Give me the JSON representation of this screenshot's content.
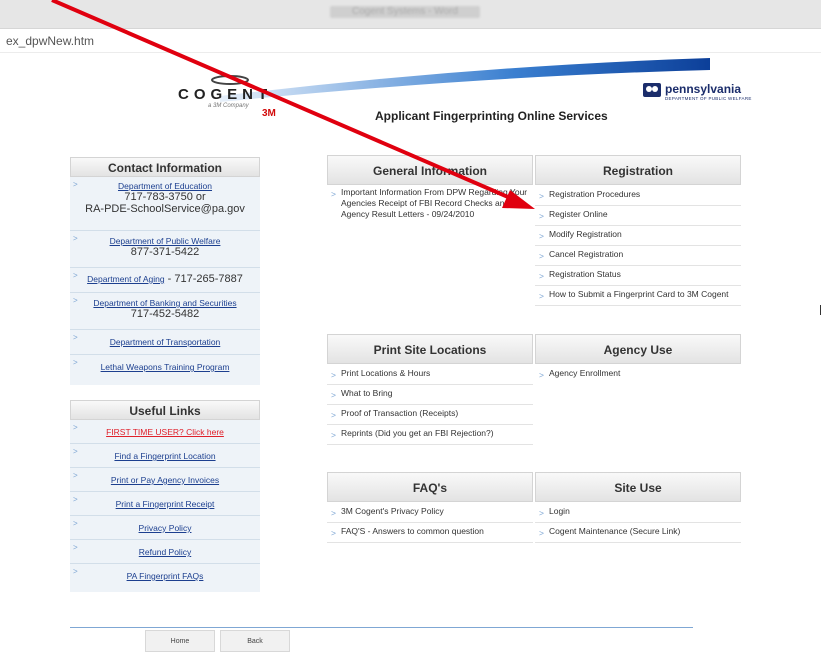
{
  "window": {
    "title": "Cogent Systems - Word"
  },
  "address": {
    "text": "ex_dpwNew.htm"
  },
  "header": {
    "logo_text": "COGENT",
    "logo_sub": "a 3M Company",
    "logo_3m": "3M",
    "pa_name": "pennsylvania",
    "pa_dept": "DEPARTMENT OF PUBLIC WELFARE",
    "site_title": "Applicant Fingerprinting Online Services"
  },
  "contact": {
    "title": "Contact Information",
    "education": {
      "label": "Department of Education",
      "phone": "717-783-3750 or",
      "email": "RA-PDE-SchoolService@pa.gov"
    },
    "welfare": {
      "label": "Department of Public Welfare",
      "phone": "877-371-5422"
    },
    "aging": {
      "label": "Department of Aging",
      "phone": " - 717-265-7887"
    },
    "banking": {
      "label": "Department of Banking and Securities",
      "phone": "717-452-5482"
    },
    "transport": {
      "label": "Department of Transportation"
    },
    "weapons": {
      "label": "Lethal Weapons Training Program"
    }
  },
  "useful": {
    "title": "Useful Links",
    "items": [
      {
        "label": "FIRST TIME USER? Click here"
      },
      {
        "label": "Find a Fingerprint Location"
      },
      {
        "label": "Print or Pay Agency Invoices"
      },
      {
        "label": "Print a Fingerprint Receipt"
      },
      {
        "label": "Privacy Policy"
      },
      {
        "label": "Refund Policy"
      },
      {
        "label": "PA Fingerprint FAQs"
      }
    ]
  },
  "general": {
    "title": "General Information",
    "items": [
      {
        "label": "Important Information From DPW Regarding Your Agencies Receipt of FBI Record Checks and Agency Result Letters - 09/24/2010"
      }
    ]
  },
  "registration": {
    "title": "Registration",
    "items": [
      {
        "label": "Registration Procedures"
      },
      {
        "label": "Register Online"
      },
      {
        "label": "Modify Registration"
      },
      {
        "label": "Cancel Registration"
      },
      {
        "label": "Registration Status"
      },
      {
        "label": "How to Submit a Fingerprint Card to 3M Cogent"
      }
    ]
  },
  "print_sites": {
    "title": "Print Site Locations",
    "items": [
      {
        "label": "Print Locations & Hours"
      },
      {
        "label": "What to Bring"
      },
      {
        "label": "Proof of Transaction (Receipts)"
      },
      {
        "label": "Reprints (Did you get an FBI Rejection?)"
      }
    ]
  },
  "agency": {
    "title": "Agency Use",
    "items": [
      {
        "label": "Agency Enrollment"
      }
    ]
  },
  "faqs": {
    "title": "FAQ's",
    "items": [
      {
        "label": "3M Cogent's Privacy Policy"
      },
      {
        "label": "FAQ'S - Answers to common question"
      }
    ]
  },
  "site_use": {
    "title": "Site Use",
    "items": [
      {
        "label": "Login"
      },
      {
        "label": "Cogent Maintenance (Secure Link)"
      }
    ]
  },
  "footer": {
    "home": "Home",
    "back": "Back"
  },
  "colors": {
    "annotation_arrow": "#e0000f",
    "sidebar_bg": "#eef3f8",
    "link_blue": "#1c3f8f"
  }
}
